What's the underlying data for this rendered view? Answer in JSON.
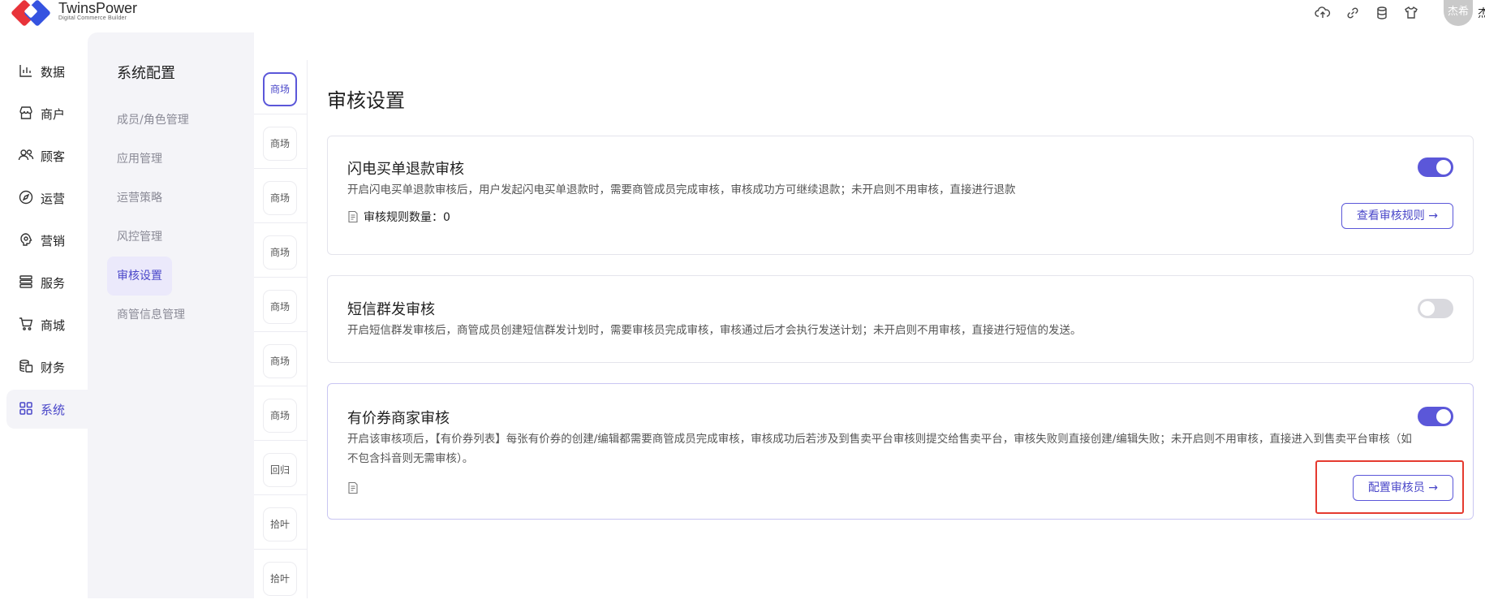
{
  "brand": {
    "name": "TwinsPower",
    "subtitle": "Digital Commerce Builder"
  },
  "topbar": {
    "icons": [
      "cloud-upload-icon",
      "link-icon",
      "database-icon",
      "shirt-icon"
    ],
    "avatar_text": "杰希",
    "user_name_fragment": "杰"
  },
  "nav": {
    "items": [
      {
        "label": "数据",
        "icon": "chart-icon"
      },
      {
        "label": "商户",
        "icon": "store-icon"
      },
      {
        "label": "顾客",
        "icon": "users-icon"
      },
      {
        "label": "运营",
        "icon": "compass-icon"
      },
      {
        "label": "营销",
        "icon": "megaphone-icon"
      },
      {
        "label": "服务",
        "icon": "list-icon"
      },
      {
        "label": "商城",
        "icon": "cart-icon"
      },
      {
        "label": "财务",
        "icon": "coins-icon"
      },
      {
        "label": "系统",
        "icon": "grid-icon",
        "active": true
      }
    ]
  },
  "sub": {
    "title": "系统配置",
    "items": [
      {
        "label": "成员/角色管理"
      },
      {
        "label": "应用管理"
      },
      {
        "label": "运营策略"
      },
      {
        "label": "风控管理"
      },
      {
        "label": "审核设置",
        "active": true
      },
      {
        "label": "商管信息管理"
      }
    ]
  },
  "tabs": [
    "商场",
    "商场",
    "商场",
    "商场",
    "商场",
    "商场",
    "商场",
    "回归",
    "拾叶",
    "拾叶"
  ],
  "main": {
    "title": "审核设置",
    "cards": [
      {
        "title": "闪电买单退款审核",
        "desc": "开启闪电买单退款审核后，用户发起闪电买单退款时，需要商管成员完成审核，审核成功方可继续退款；未开启则不用审核，直接进行退款",
        "rule_label": "审核规则数量：",
        "rule_count": "0",
        "toggle": "on",
        "button": "查看审核规则 →"
      },
      {
        "title": "短信群发审核",
        "desc": "开启短信群发审核后，商管成员创建短信群发计划时，需要审核员完成审核，审核通过后才会执行发送计划；未开启则不用审核，直接进行短信的发送。",
        "toggle": "off"
      },
      {
        "title": "有价券商家审核",
        "desc_line1": "开启该审核项后，【有价券列表】每张有价券的创建/编辑都需要商管成员完成审核，审核成功后若涉及到售卖平台审核则提交给售卖平台，审核失败则直接创建/编辑失败；未开启则不用审核，直接进入到售卖平台审核（如",
        "desc_line2": "不包含抖音则无需审核）。",
        "toggle": "on",
        "button": "配置审核员 →"
      }
    ]
  },
  "colors": {
    "accent": "#5b57d9",
    "highlight_box": "#e53a2f"
  }
}
